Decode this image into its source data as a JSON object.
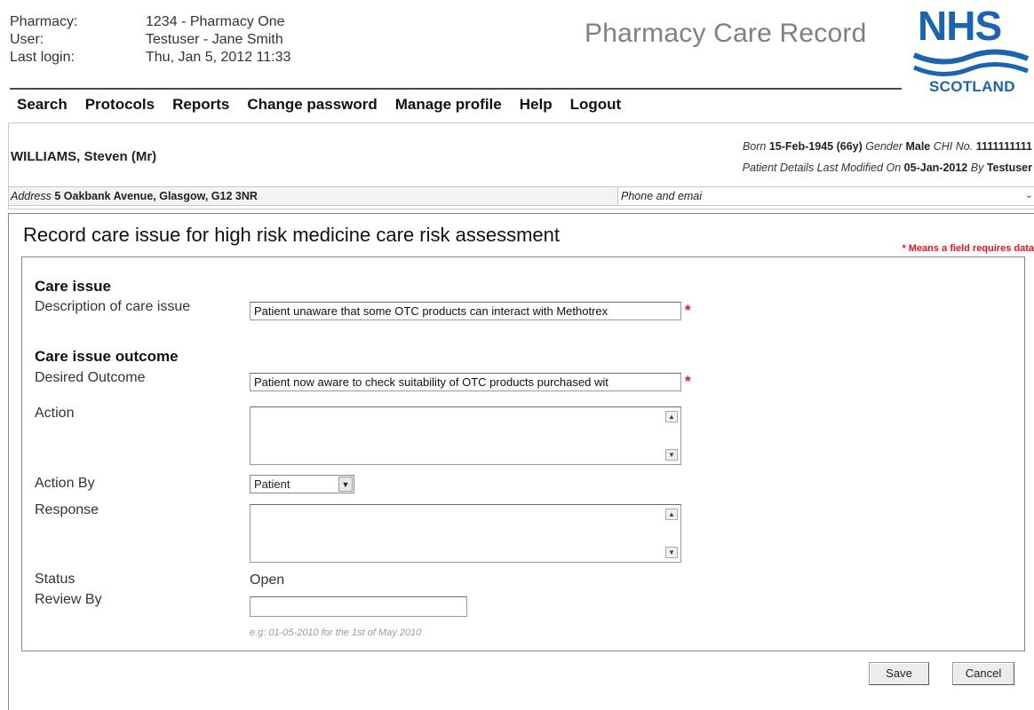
{
  "header": {
    "info": [
      {
        "key": "Pharmacy:",
        "value": "1234 - Pharmacy One"
      },
      {
        "key": "User:",
        "value": "Testuser - Jane Smith"
      },
      {
        "key": "Last login:",
        "value": "Thu, Jan 5, 2012 11:33"
      }
    ],
    "app_title": "Pharmacy Care Record",
    "logo": {
      "nhs": "NHS",
      "scotland": "SCOTLAND",
      "color": "#1a64b0"
    }
  },
  "nav": [
    "Search",
    "Protocols",
    "Reports",
    "Change password",
    "Manage profile",
    "Help",
    "Logout"
  ],
  "patient": {
    "name": "WILLIAMS, Steven (Mr)",
    "born_label": "Born",
    "born_value": "15-Feb-1945",
    "age": "(66y)",
    "gender_label": "Gender",
    "gender_value": "Male",
    "chi_label": "CHI No.",
    "chi_value": "1111111111",
    "modified_label": "Patient Details Last Modified On",
    "modified_date": "05-Jan-2012",
    "by_label": "By",
    "by_value": "Testuser",
    "address_label": "Address",
    "address_value": "5 Oakbank Avenue, Glasgow, G12 3NR",
    "phone_label": "Phone and emai"
  },
  "form": {
    "title": "Record care issue for high risk medicine care risk assessment",
    "required_note": "* Means a field requires data",
    "care_issue_heading": "Care issue",
    "description_label": "Description of care issue",
    "description_value": "Patient unaware that some OTC products can interact with Methotrex",
    "outcome_heading": "Care issue outcome",
    "desired_outcome_label": "Desired Outcome",
    "desired_outcome_value": "Patient now aware to check suitability of OTC products purchased wit",
    "action_label": "Action",
    "action_by_label": "Action By",
    "action_by_value": "Patient",
    "response_label": "Response",
    "status_label": "Status",
    "status_value": "Open",
    "review_by_label": "Review By",
    "review_by_value": "",
    "review_hint": "e.g: 01-05-2010 for the 1st of May 2010",
    "required_marker": "*"
  },
  "buttons": {
    "save": "Save",
    "cancel": "Cancel"
  }
}
